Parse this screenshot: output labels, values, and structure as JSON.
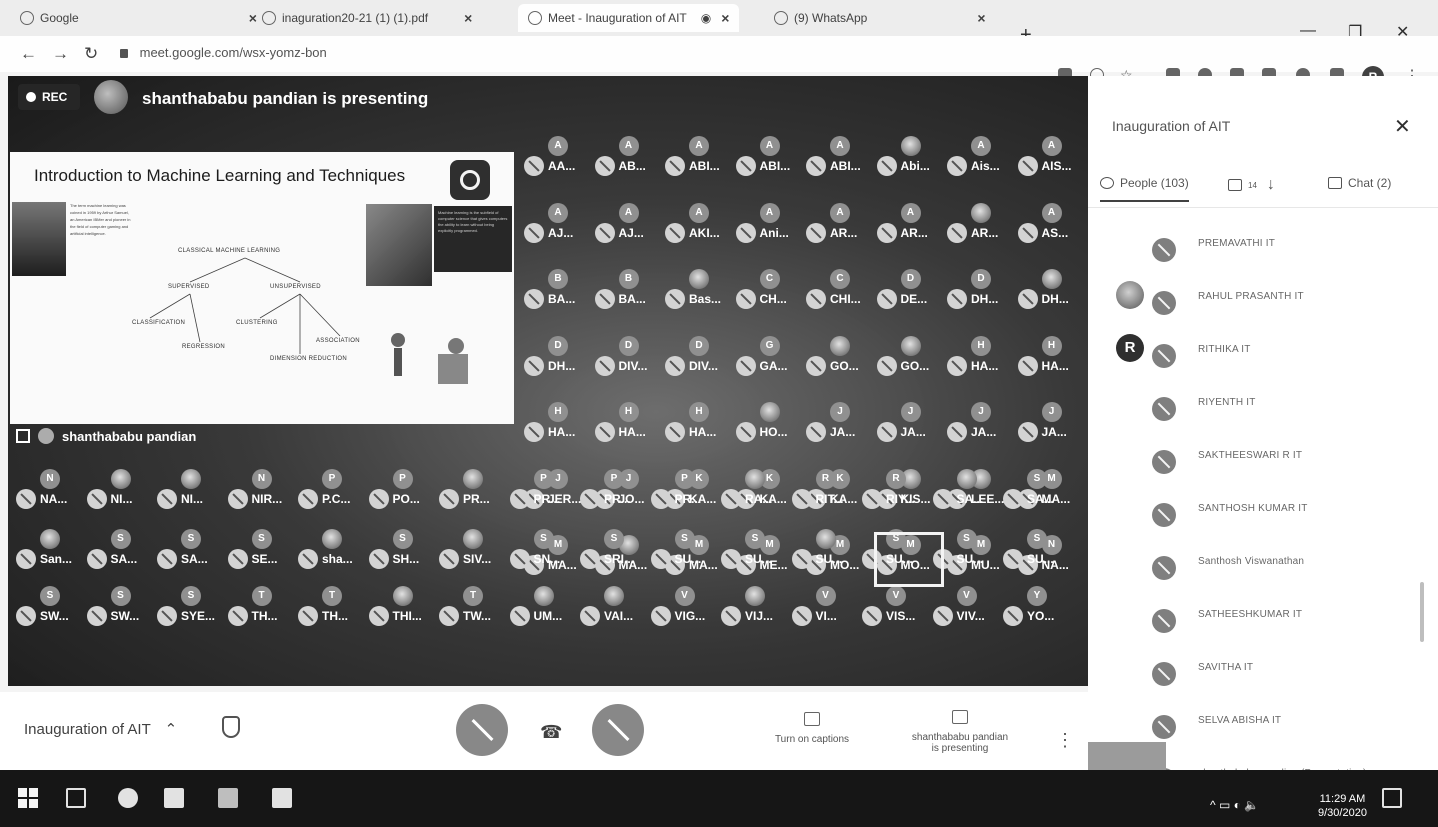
{
  "browser": {
    "tabs": [
      {
        "title": "Google",
        "active": false
      },
      {
        "title": "inaguration20-21 (1) (1).pdf",
        "active": false
      },
      {
        "title": "Meet - Inauguration of AIT",
        "active": true
      },
      {
        "title": "(9) WhatsApp",
        "active": false
      }
    ],
    "url": "meet.google.com/wsx-yomz-bon",
    "profile_initial": "R"
  },
  "meet": {
    "rec_label": "REC",
    "presenting_text": "shanthababu pandian is presenting",
    "presenter_tile_name": "shanthababu pandian",
    "slide": {
      "title": "Introduction to Machine Learning and Techniques",
      "blurb": "The term machine learning was coined in 1959 by Arthur Samuel, an American IBMer and pioneer in the field of computer gaming and artificial intelligence.",
      "quote": "Machine learning is the subfield of computer science that gives computers the ability to learn without being explicitly programmed.",
      "diagram": {
        "root": "CLASSICAL MACHINE LEARNING",
        "left": "SUPERVISED",
        "right": "UNSUPERVISED",
        "left_children": [
          "CLASSIFICATION",
          "REGRESSION"
        ],
        "right_children": [
          "CLUSTERING",
          "ASSOCIATION",
          "DIMENSION REDUCTION"
        ]
      }
    },
    "participants_grid": [
      {
        "av": "A",
        "name": "AA..."
      },
      {
        "av": "A",
        "name": "AB..."
      },
      {
        "av": "A",
        "name": "ABI..."
      },
      {
        "av": "A",
        "name": "ABI..."
      },
      {
        "av": "A",
        "name": "ABI..."
      },
      {
        "av": "pic",
        "name": "Abi..."
      },
      {
        "av": "A",
        "name": "Ais..."
      },
      {
        "av": "A",
        "name": "AIS..."
      },
      {
        "av": "A",
        "name": "AJ..."
      },
      {
        "av": "A",
        "name": "AJ..."
      },
      {
        "av": "A",
        "name": "AKI..."
      },
      {
        "av": "A",
        "name": "Ani..."
      },
      {
        "av": "A",
        "name": "AR..."
      },
      {
        "av": "A",
        "name": "AR..."
      },
      {
        "av": "pic",
        "name": "AR..."
      },
      {
        "av": "A",
        "name": "AS..."
      },
      {
        "av": "B",
        "name": "BA..."
      },
      {
        "av": "B",
        "name": "BA..."
      },
      {
        "av": "pic",
        "name": "Bas..."
      },
      {
        "av": "C",
        "name": "CH..."
      },
      {
        "av": "C",
        "name": "CHI..."
      },
      {
        "av": "D",
        "name": "DE..."
      },
      {
        "av": "D",
        "name": "DH..."
      },
      {
        "av": "pic",
        "name": "DH..."
      },
      {
        "av": "D",
        "name": "DH..."
      },
      {
        "av": "D",
        "name": "DIV..."
      },
      {
        "av": "D",
        "name": "DIV..."
      },
      {
        "av": "G",
        "name": "GA..."
      },
      {
        "av": "pic",
        "name": "GO..."
      },
      {
        "av": "pic",
        "name": "GO..."
      },
      {
        "av": "H",
        "name": "HA..."
      },
      {
        "av": "H",
        "name": "HA..."
      },
      {
        "av": "H",
        "name": "HA..."
      },
      {
        "av": "H",
        "name": "HA..."
      },
      {
        "av": "H",
        "name": "HA..."
      },
      {
        "av": "pic",
        "name": "HO..."
      },
      {
        "av": "J",
        "name": "JA..."
      },
      {
        "av": "J",
        "name": "JA..."
      },
      {
        "av": "J",
        "name": "JA..."
      },
      {
        "av": "J",
        "name": "JA..."
      },
      {
        "av": "J",
        "name": "JER..."
      },
      {
        "av": "J",
        "name": "JO..."
      },
      {
        "av": "K",
        "name": "KA..."
      },
      {
        "av": "K",
        "name": "KA..."
      },
      {
        "av": "K",
        "name": "KA..."
      },
      {
        "av": "pic",
        "name": "KIS..."
      },
      {
        "av": "pic",
        "name": "LEE..."
      },
      {
        "av": "M",
        "name": "MA..."
      },
      {
        "av": "M",
        "name": "MA..."
      },
      {
        "av": "pic",
        "name": "MA..."
      },
      {
        "av": "M",
        "name": "MA..."
      },
      {
        "av": "M",
        "name": "ME..."
      },
      {
        "av": "M",
        "name": "MO..."
      },
      {
        "av": "M",
        "name": "MO..."
      },
      {
        "av": "M",
        "name": "MU..."
      },
      {
        "av": "N",
        "name": "NA..."
      },
      {
        "av": "N",
        "name": "NA..."
      },
      {
        "av": "pic",
        "name": "NI..."
      },
      {
        "av": "pic",
        "name": "NI..."
      },
      {
        "av": "N",
        "name": "NIR..."
      },
      {
        "av": "P",
        "name": "P.C..."
      },
      {
        "av": "P",
        "name": "PO..."
      },
      {
        "av": "pic",
        "name": "PR..."
      },
      {
        "av": "P",
        "name": "PR..."
      },
      {
        "av": "P",
        "name": "PR..."
      },
      {
        "av": "P",
        "name": "PR..."
      },
      {
        "av": "pic",
        "name": "RA..."
      },
      {
        "av": "R",
        "name": "RIT..."
      },
      {
        "av": "R",
        "name": "RIY..."
      },
      {
        "av": "pic",
        "name": "SA..."
      },
      {
        "av": "S",
        "name": "SA..."
      },
      {
        "av": "pic",
        "name": "San..."
      },
      {
        "av": "S",
        "name": "SA..."
      },
      {
        "av": "S",
        "name": "SA..."
      },
      {
        "av": "S",
        "name": "SE..."
      },
      {
        "av": "pic",
        "name": "sha..."
      },
      {
        "av": "S",
        "name": "SH..."
      },
      {
        "av": "pic",
        "name": "SIV..."
      },
      {
        "av": "S",
        "name": "SN..."
      },
      {
        "av": "S",
        "name": "SRI..."
      },
      {
        "av": "S",
        "name": "SU..."
      },
      {
        "av": "S",
        "name": "SU..."
      },
      {
        "av": "pic",
        "name": "SU..."
      },
      {
        "av": "S",
        "name": "SU..."
      },
      {
        "av": "S",
        "name": "SU..."
      },
      {
        "av": "S",
        "name": "SU..."
      },
      {
        "av": "S",
        "name": "SW..."
      },
      {
        "av": "S",
        "name": "SW..."
      },
      {
        "av": "S",
        "name": "SYE..."
      },
      {
        "av": "T",
        "name": "TH..."
      },
      {
        "av": "T",
        "name": "TH..."
      },
      {
        "av": "pic",
        "name": "THI..."
      },
      {
        "av": "T",
        "name": "TW..."
      },
      {
        "av": "pic",
        "name": "UM..."
      },
      {
        "av": "pic",
        "name": "VAI..."
      },
      {
        "av": "V",
        "name": "VIG..."
      },
      {
        "av": "pic",
        "name": "VIJ..."
      },
      {
        "av": "V",
        "name": "VI..."
      },
      {
        "av": "V",
        "name": "VIS..."
      },
      {
        "av": "V",
        "name": "VIV..."
      },
      {
        "av": "Y",
        "name": "YO..."
      }
    ],
    "bottom_bar": {
      "meeting_name": "Inauguration of AIT",
      "captions_label": "Turn on captions",
      "presenting_label": "shanthababu pandian is presenting"
    }
  },
  "panel": {
    "title": "Inauguration of AIT",
    "people_tab": "People (103)",
    "activities_badge": "14",
    "chat_tab": "Chat (2)",
    "people": [
      {
        "name": "PREMAVATHI IT",
        "avatar": ""
      },
      {
        "name": "RAHUL PRASANTH IT",
        "avatar": "pic"
      },
      {
        "name": "RITHIKA IT",
        "avatar": "R"
      },
      {
        "name": "RIYENTH IT",
        "avatar": ""
      },
      {
        "name": "SAKTHEESWARI R IT",
        "avatar": ""
      },
      {
        "name": "SANTHOSH KUMAR IT",
        "avatar": ""
      },
      {
        "name": "Santhosh Viswanathan",
        "avatar": ""
      },
      {
        "name": "SATHEESHKUMAR IT",
        "avatar": ""
      },
      {
        "name": "SAVITHA IT",
        "avatar": ""
      },
      {
        "name": "SELVA ABISHA IT",
        "avatar": ""
      },
      {
        "name": "shanthababu pandian (Presentation)",
        "avatar": ""
      }
    ]
  },
  "taskbar": {
    "time": "11:29 AM",
    "date": "9/30/2020"
  }
}
